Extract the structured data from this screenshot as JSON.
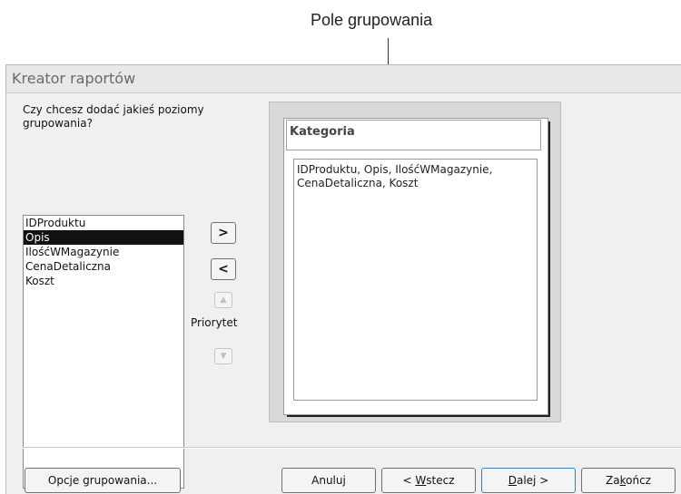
{
  "callout": {
    "label": "Pole grupowania"
  },
  "window": {
    "title": "Kreator raportów"
  },
  "question": {
    "line1": "Czy chcesz dodać jakieś poziomy",
    "line2": "grupowania?"
  },
  "field_list": {
    "items": [
      "IDProduktu",
      "Opis",
      "IlośćWMagazynie",
      "CenaDetaliczna",
      "Koszt"
    ],
    "selected": "Opis"
  },
  "arrows": {
    "add": ">",
    "remove": "<",
    "up": "▲",
    "down": "▼",
    "priority_label": "Priorytet"
  },
  "preview": {
    "group_field": "Kategoria",
    "detail_line1": "IDProduktu, Opis, IlośćWMagazynie,",
    "detail_line2": "CenaDetaliczna, Koszt"
  },
  "buttons": {
    "group_options": "Opcje grupowania...",
    "cancel": "Anuluj",
    "back_prefix": "< ",
    "back_underlined": "W",
    "back_rest": "stecz",
    "next_underlined": "D",
    "next_rest": "alej >",
    "finish_start": "Za",
    "finish_underlined": "k",
    "finish_rest": "ończ"
  }
}
